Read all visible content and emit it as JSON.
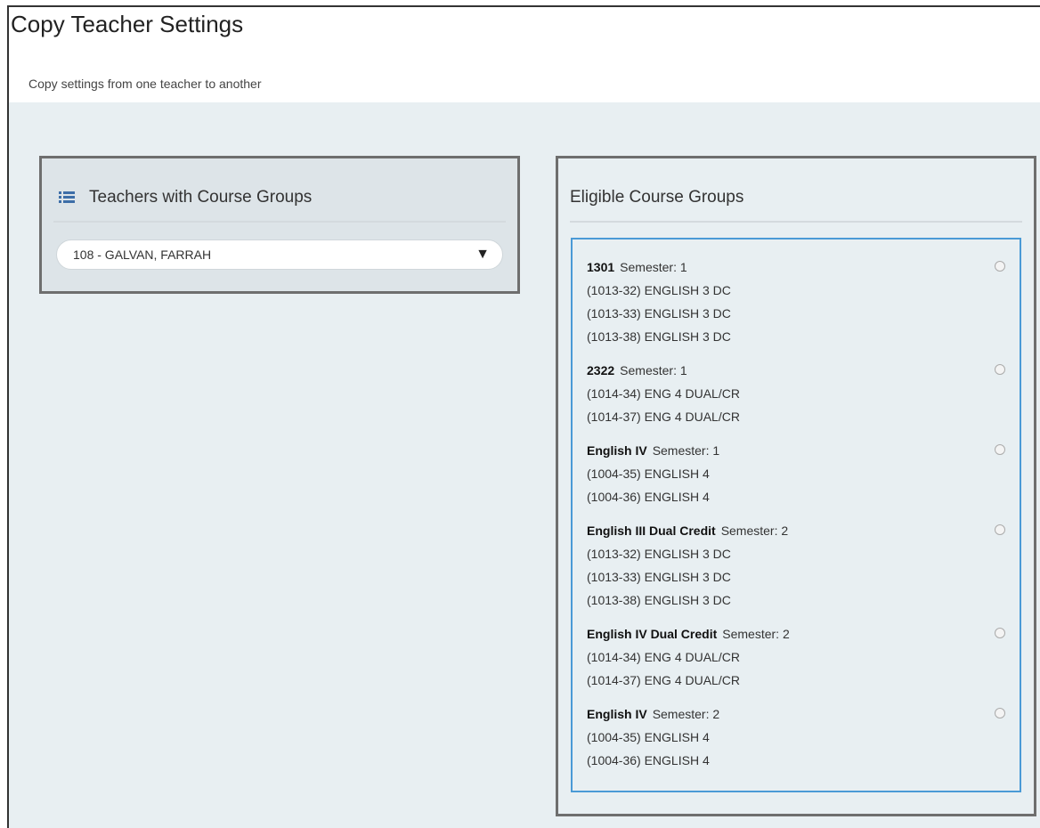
{
  "page": {
    "title": "Copy Teacher Settings",
    "subtitle": "Copy settings from one teacher to another"
  },
  "left_panel": {
    "header": "Teachers with Course Groups",
    "icon": "list-icon",
    "teacher_select": {
      "value": "108 - GALVAN, FARRAH",
      "arrow": "▼"
    }
  },
  "right_panel": {
    "header": "Eligible Course Groups",
    "groups": [
      {
        "name": "1301",
        "semester": "Semester: 1",
        "courses": [
          "(1013-32) ENGLISH 3 DC",
          "(1013-33) ENGLISH 3 DC",
          "(1013-38) ENGLISH 3 DC"
        ]
      },
      {
        "name": "2322",
        "semester": "Semester: 1",
        "courses": [
          "(1014-34) ENG 4 DUAL/CR",
          "(1014-37) ENG 4 DUAL/CR"
        ]
      },
      {
        "name": "English IV",
        "semester": "Semester: 1",
        "courses": [
          "(1004-35) ENGLISH 4",
          "(1004-36) ENGLISH 4"
        ]
      },
      {
        "name": "English III Dual Credit",
        "semester": "Semester: 2",
        "courses": [
          "(1013-32) ENGLISH 3 DC",
          "(1013-33) ENGLISH 3 DC",
          "(1013-38) ENGLISH 3 DC"
        ]
      },
      {
        "name": "English IV Dual Credit",
        "semester": "Semester: 2",
        "courses": [
          "(1014-34) ENG 4 DUAL/CR",
          "(1014-37) ENG 4 DUAL/CR"
        ]
      },
      {
        "name": "English IV",
        "semester": "Semester: 2",
        "courses": [
          "(1004-35) ENGLISH 4",
          "(1004-36) ENGLISH 4"
        ]
      }
    ]
  }
}
